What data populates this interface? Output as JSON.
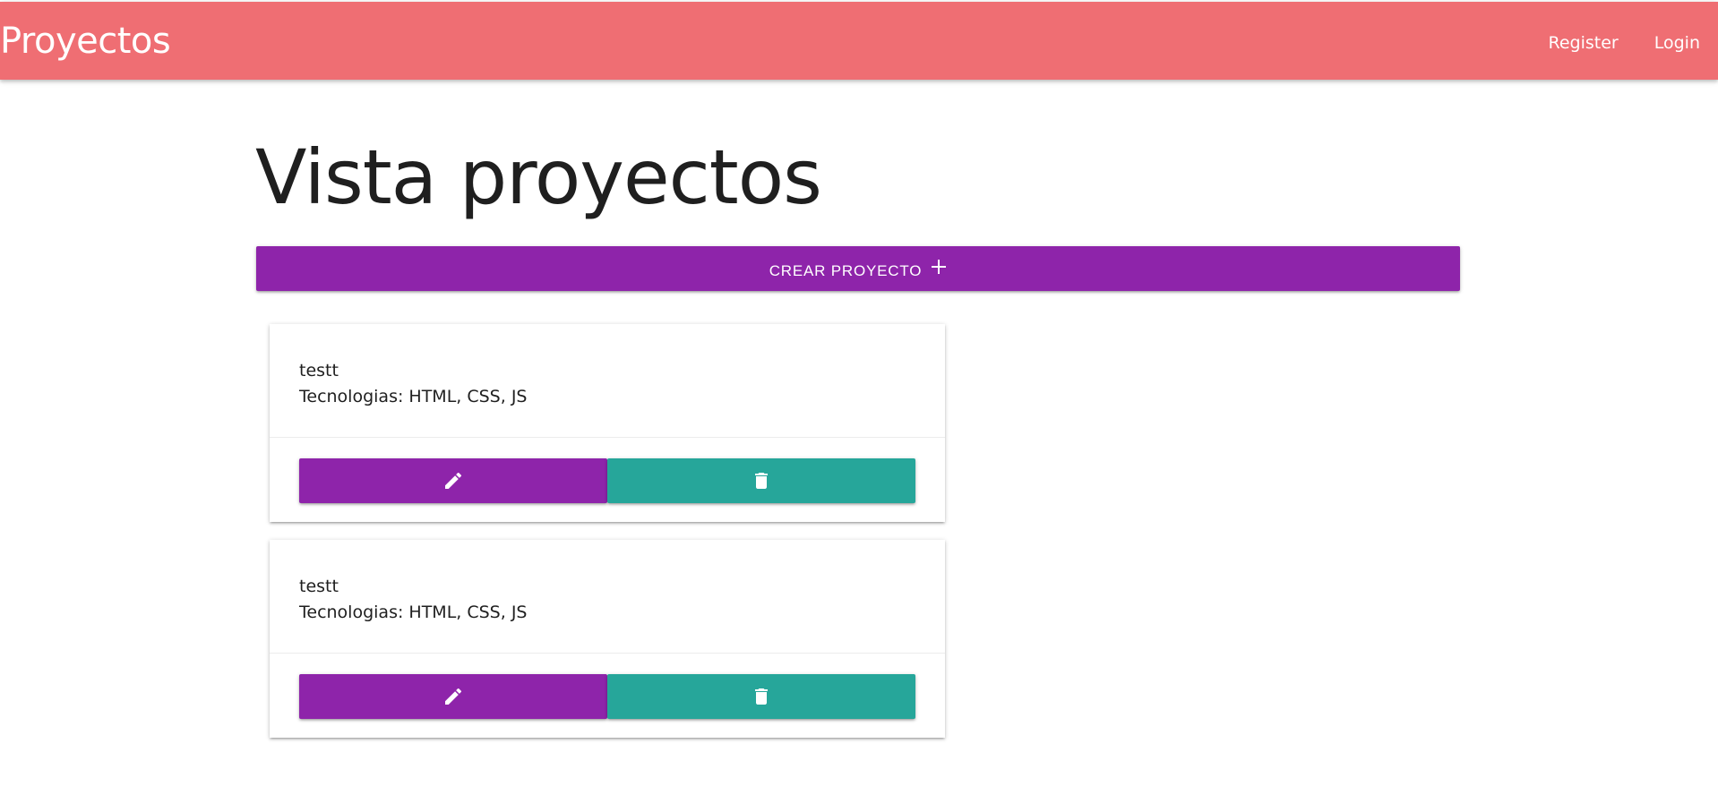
{
  "navbar": {
    "brand": "Proyectos",
    "links": [
      {
        "label": "Register"
      },
      {
        "label": "Login"
      }
    ],
    "color": "#ef6e73"
  },
  "main": {
    "title": "Vista proyectos",
    "create_button": {
      "label": "Crear proyecto",
      "icon": "plus-icon",
      "color": "#8e24aa"
    },
    "projects": [
      {
        "name": "testt",
        "technologies": "Tecnologias: HTML, CSS, JS",
        "edit_icon": "pencil-icon",
        "delete_icon": "trash-icon"
      },
      {
        "name": "testt",
        "technologies": "Tecnologias: HTML, CSS, JS",
        "edit_icon": "pencil-icon",
        "delete_icon": "trash-icon"
      }
    ],
    "edit_color": "#8e24aa",
    "delete_color": "#26a69a"
  }
}
